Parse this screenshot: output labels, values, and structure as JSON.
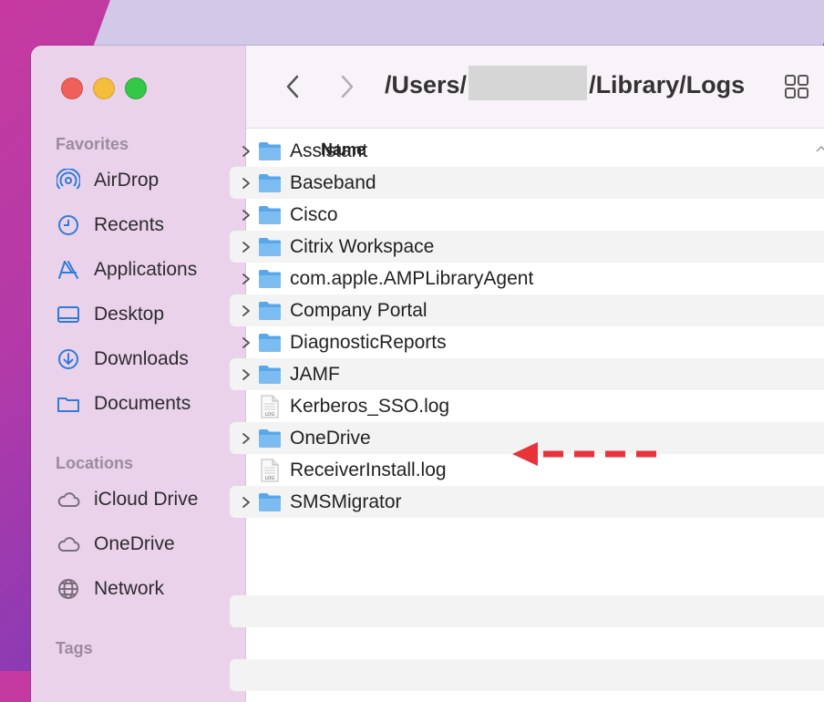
{
  "window": {
    "path_prefix": "/Users/",
    "path_suffix": "/Library/Logs"
  },
  "sidebar": {
    "favorites_heading": "Favorites",
    "favorites": [
      {
        "label": "AirDrop",
        "icon": "airdrop-icon"
      },
      {
        "label": "Recents",
        "icon": "clock-icon"
      },
      {
        "label": "Applications",
        "icon": "applications-icon"
      },
      {
        "label": "Desktop",
        "icon": "desktop-icon"
      },
      {
        "label": "Downloads",
        "icon": "downloads-icon"
      },
      {
        "label": "Documents",
        "icon": "folder-icon"
      }
    ],
    "locations_heading": "Locations",
    "locations": [
      {
        "label": "iCloud Drive",
        "icon": "cloud-icon"
      },
      {
        "label": "OneDrive",
        "icon": "cloud-icon"
      },
      {
        "label": "Network",
        "icon": "globe-icon"
      }
    ],
    "tags_heading": "Tags"
  },
  "list": {
    "column_name": "Name",
    "rows": [
      {
        "label": "Assistant",
        "type": "folder"
      },
      {
        "label": "Baseband",
        "type": "folder"
      },
      {
        "label": "Cisco",
        "type": "folder"
      },
      {
        "label": "Citrix Workspace",
        "type": "folder"
      },
      {
        "label": "com.apple.AMPLibraryAgent",
        "type": "folder"
      },
      {
        "label": "Company Portal",
        "type": "folder"
      },
      {
        "label": "DiagnosticReports",
        "type": "folder"
      },
      {
        "label": "JAMF",
        "type": "folder"
      },
      {
        "label": "Kerberos_SSO.log",
        "type": "log"
      },
      {
        "label": "OneDrive",
        "type": "folder"
      },
      {
        "label": "ReceiverInstall.log",
        "type": "log"
      },
      {
        "label": "SMSMigrator",
        "type": "folder"
      }
    ]
  },
  "colors": {
    "accent": "#2f7bd8",
    "folder": "#5aa7e8",
    "annotation_arrow": "#e8333b"
  }
}
